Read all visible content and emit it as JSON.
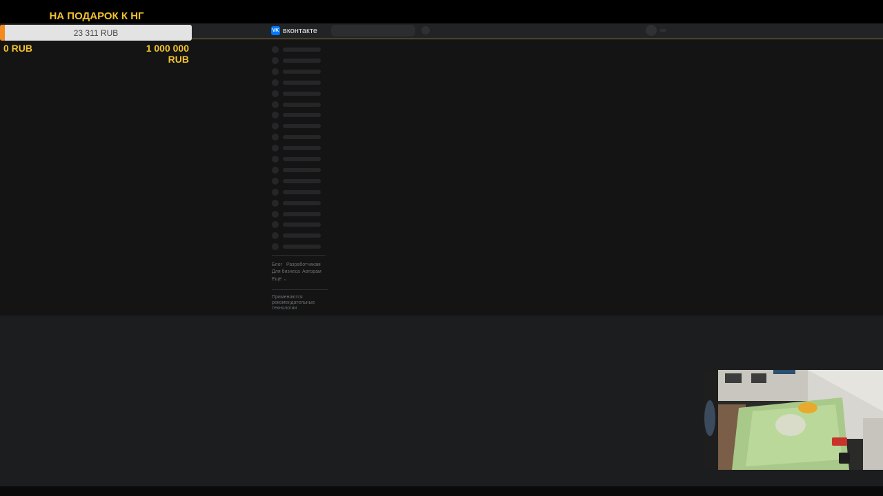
{
  "donation": {
    "title": "НА ПОДАРОК К НГ",
    "current": "23 311 RUB",
    "min_label": "0 RUB",
    "max_label": "1 000 000 RUB",
    "progress_fraction": 0.023311,
    "accent_color": "#f2c230",
    "fill_color": "#f28a1e"
  },
  "vk": {
    "logo_text": "вконтакте",
    "logo_icon": "vk-icon",
    "brand_color": "#0077ff",
    "menu_placeholder_count": 19,
    "footer": {
      "blog": "Блог",
      "developers": "Разработчикам",
      "business": "Для бизнеса",
      "authors": "Авторам",
      "more": "Ещё",
      "recommend_line1": "Применяются",
      "recommend_line2": "рекомендательные",
      "recommend_line3": "технологии"
    }
  },
  "webcam": {
    "icon": "webcam-feed"
  }
}
